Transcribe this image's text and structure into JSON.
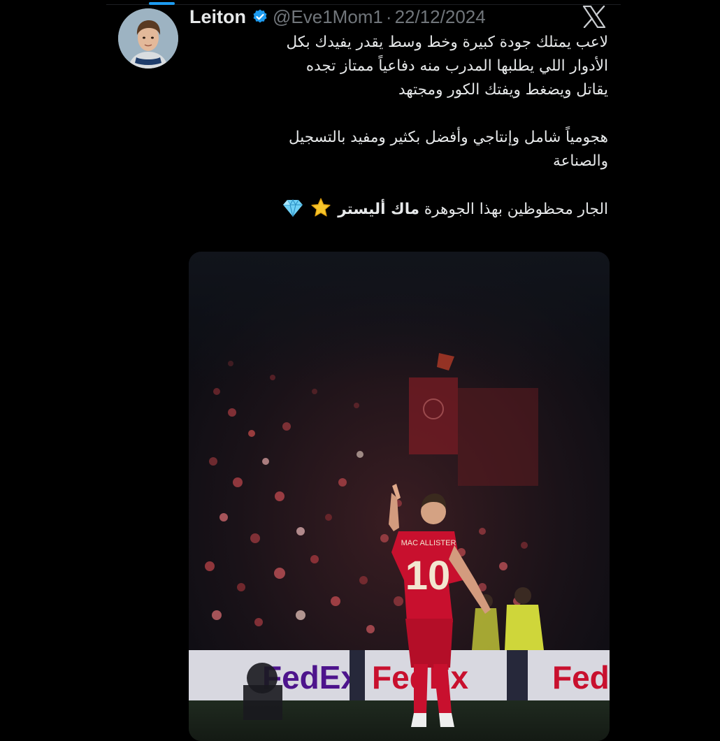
{
  "tweet": {
    "author": {
      "display_name": "Leiton",
      "handle": "@Eve1Mom1",
      "verified": true
    },
    "separator": "·",
    "date": "22/12/2024",
    "platform_icon": "x-logo-icon",
    "body": {
      "line1": "لاعب يمتلك جودة كبيرة وخط وسط يقدر يفيدك بكل",
      "line2": "الأدوار اللي يطلبها المدرب منه دفاعياً ممتاز تجده",
      "line3": "يقاتل ويضغط ويفتك الكور ومجتهد",
      "line4": "هجومياً شامل وإنتاجي وأفضل بكثير ومفيد بالتسجيل",
      "line5": "والصناعة",
      "line6_prefix": "الجار محظوظين بهذا الجوهرة",
      "line6_bold": "ماك أليستر",
      "emojis": [
        "star-icon",
        "gem-icon"
      ]
    },
    "media": {
      "jersey_name": "MAC ALLISTER",
      "jersey_number": "10",
      "board_text_1": "FedEx",
      "board_text_2": "FedEx",
      "board_text_3": "FedEx"
    }
  },
  "colors": {
    "background": "#000000",
    "text": "#e7e9ea",
    "muted": "#71767b",
    "verified_blue": "#1d9bf0",
    "kit_red": "#c8102e"
  }
}
